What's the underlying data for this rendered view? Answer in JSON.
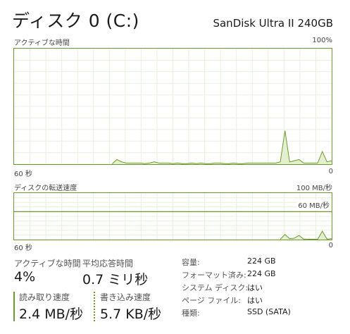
{
  "header": {
    "title": "ディスク 0 (C:)",
    "model": "SanDisk Ultra II 240GB"
  },
  "active_time_graph": {
    "label": "アクティブな時間",
    "max_label": "100%",
    "time_label": "60 秒",
    "min_label": "0"
  },
  "transfer_graph": {
    "label": "ディスクの転送速度",
    "max_label": "100 MB/秒",
    "reference_line_label": "60 MB/秒",
    "time_label": "60 秒",
    "min_label": "0"
  },
  "stats": {
    "active_time": {
      "label": "アクティブな時間",
      "value": "4%"
    },
    "avg_response": {
      "label": "平均応答時間",
      "value": "0.7 ミリ秒"
    },
    "read_speed": {
      "label": "読み取り速度",
      "value": "2.4 MB/秒"
    },
    "write_speed": {
      "label": "書き込み速度",
      "value": "5.7 KB/秒"
    }
  },
  "properties": [
    {
      "key": "容量:",
      "value": "224 GB"
    },
    {
      "key": "フォーマット済み:",
      "value": "224 GB"
    },
    {
      "key": "システム ディスク:",
      "value": "はい"
    },
    {
      "key": "ページ ファイル:",
      "value": "はい"
    },
    {
      "key": "種類:",
      "value": "SSD (SATA)"
    }
  ],
  "colors": {
    "accent": "#6b9a2e",
    "fill": "#e3efcf",
    "grid": "#e8f0dc"
  },
  "chart_data": [
    {
      "type": "area",
      "series": [
        {
          "values": [
            0,
            0,
            0,
            0,
            0,
            0,
            0,
            0,
            0,
            0,
            0,
            0,
            0,
            0,
            0,
            0,
            0,
            0,
            0,
            0,
            0,
            0,
            4,
            2,
            1,
            1,
            1,
            1,
            0.5,
            1,
            2,
            1,
            1,
            1,
            0.5,
            1,
            0.5,
            0.5,
            1,
            0.5,
            1,
            0.5,
            0.5,
            1,
            1,
            0.5,
            0.5,
            1,
            0.5,
            0.5,
            1,
            1,
            1,
            1,
            1,
            1,
            1,
            2,
            29,
            2,
            3,
            4,
            1,
            1,
            1,
            1,
            11,
            2,
            3
          ]
        }
      ],
      "ylim": [
        0,
        100
      ],
      "grid": true
    },
    {
      "type": "area",
      "series": [
        {
          "values": [
            0,
            0,
            0,
            0,
            0,
            0,
            0,
            0,
            0,
            0,
            0,
            0,
            0,
            0,
            0,
            0,
            0,
            0,
            0,
            0,
            0,
            0,
            0,
            0,
            0,
            0,
            0,
            0,
            0,
            0,
            0,
            0,
            0,
            0,
            0,
            0,
            0,
            0,
            0,
            0,
            0,
            0,
            0,
            0,
            0,
            0,
            0,
            0,
            0,
            0,
            0,
            0,
            0,
            0,
            0,
            0,
            0,
            0,
            11,
            2,
            3,
            9,
            1,
            0,
            0,
            0,
            18,
            1,
            2
          ]
        }
      ],
      "reference_line": 60,
      "ylim": [
        0,
        100
      ],
      "grid": true
    }
  ]
}
